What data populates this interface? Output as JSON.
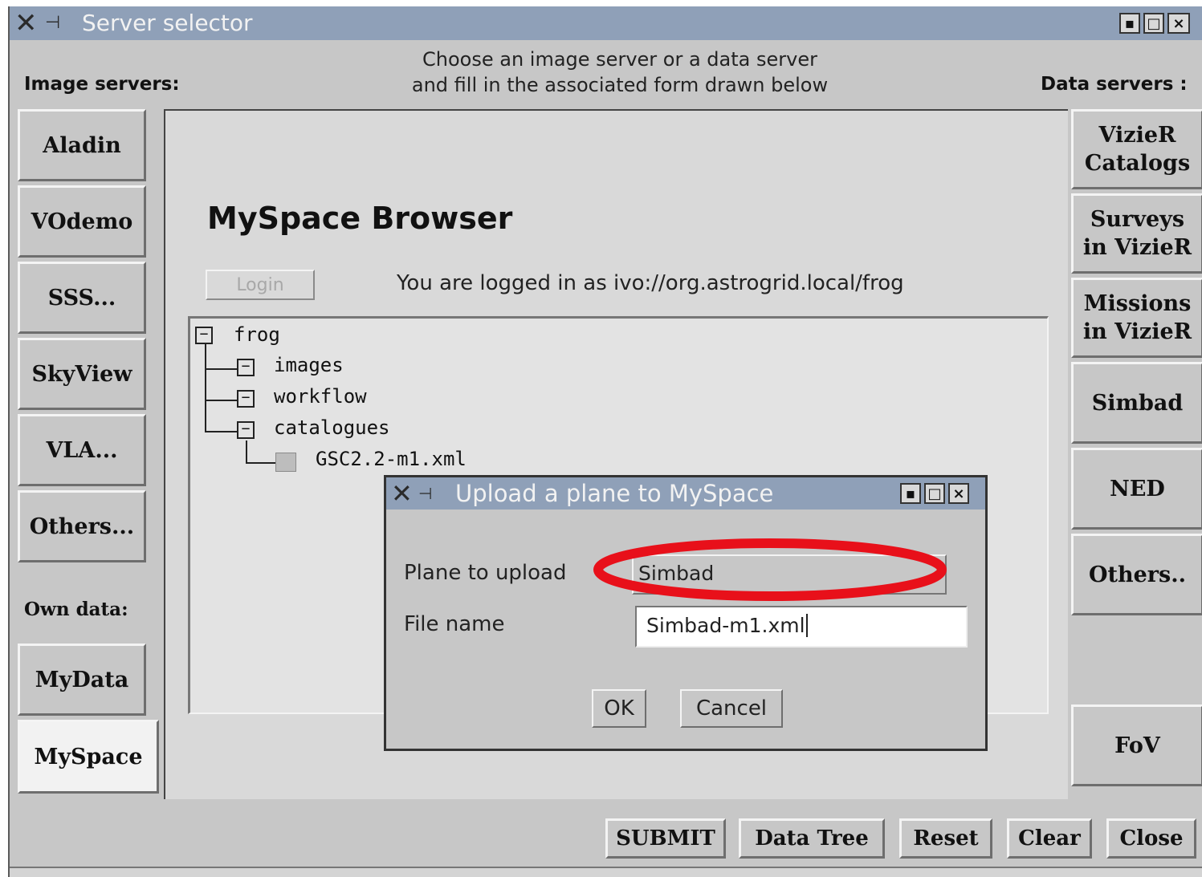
{
  "window": {
    "title": "Server selector",
    "instruction_line1": "Choose an image server or a data server",
    "instruction_line2": "and fill in the associated form drawn below"
  },
  "left": {
    "heading": "Image servers:",
    "buttons": [
      "Aladin",
      "VOdemo",
      "SSS...",
      "SkyView",
      "VLA...",
      "Others..."
    ],
    "own_heading": "Own data:",
    "own_buttons": [
      "MyData",
      "MySpace"
    ],
    "active": "MySpace"
  },
  "right": {
    "heading": "Data servers :",
    "buttons": [
      {
        "line1": "VizieR",
        "line2": "Catalogs"
      },
      {
        "line1": "Surveys",
        "line2": "in VizieR"
      },
      {
        "line1": "Missions",
        "line2": "in VizieR"
      },
      {
        "line1": "Simbad",
        "line2": ""
      },
      {
        "line1": "NED",
        "line2": ""
      },
      {
        "line1": "Others..",
        "line2": ""
      },
      {
        "line1": "FoV",
        "line2": ""
      }
    ]
  },
  "browser": {
    "title": "MySpace Browser",
    "login_label": "Login",
    "status": "You are logged in as ivo://org.astrogrid.local/frog",
    "tree": {
      "root": "frog",
      "folders": [
        "images",
        "workflow",
        "catalogues"
      ],
      "file": "GSC2.2-m1.xml",
      "expander_glyph": "−"
    }
  },
  "dialog": {
    "title": "Upload a plane to MySpace",
    "plane_label": "Plane to upload",
    "plane_value": "Simbad",
    "file_label": "File name",
    "file_value": "Simbad-m1.xml",
    "ok": "OK",
    "cancel": "Cancel"
  },
  "bottom": {
    "buttons": [
      "SUBMIT",
      "Data Tree",
      "Reset",
      "Clear",
      "Close"
    ]
  },
  "window_buttons": {
    "minimize": "▪",
    "maximize": "□",
    "close": "×"
  },
  "colors": {
    "highlight_ring": "#e8101a",
    "titlebar": "#8fa0b8"
  },
  "icons": [
    "x-logo-icon",
    "pin-icon",
    "minimize-icon",
    "maximize-icon",
    "close-icon",
    "dropdown-arrow-icon",
    "file-icon"
  ]
}
